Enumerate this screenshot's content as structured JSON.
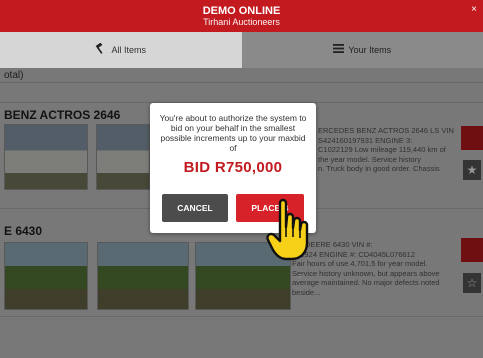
{
  "header": {
    "title": "DEMO ONLINE",
    "subtitle": "Tirhani Auctioneers",
    "close_label": "×"
  },
  "tabs": [
    {
      "label": "All Items",
      "icon": "gavel-icon"
    },
    {
      "label": "Your Items",
      "icon": "list-icon"
    }
  ],
  "content": {
    "total_label": "otal)",
    "lots": [
      {
        "title": "BENZ ACTROS 2646",
        "description": "ERCEDES BENZ ACTROS 2646 LS VIN\nS424160197931 ENGINE 3:\nC1022129 Low mileage 119,440 km of\nthe year model. Service history\nn. Truck body in good order. Chassis"
      },
      {
        "title": "E 6430",
        "description": "HN DEERE 6430 VIN #:\n591924 ENGINE #: CD4045L076612\nFair hours of use 4,701.5 for year model.\nService history unknown, but appears above\naverage maintained. No major defects noted\nbeside..."
      }
    ]
  },
  "dialog": {
    "message": "You're about to authorize the system to bid on your behalf in the smallest possible increments up to your maxbid of",
    "bid_amount": "BID R750,000",
    "cancel_label": "CANCEL",
    "place_label": "PLACE B"
  },
  "colors": {
    "brand_red": "#c21a1f",
    "button_dark": "#4c4c4c"
  },
  "icons": {
    "star": "star-icon",
    "pointer": "hand-pointer-icon"
  }
}
